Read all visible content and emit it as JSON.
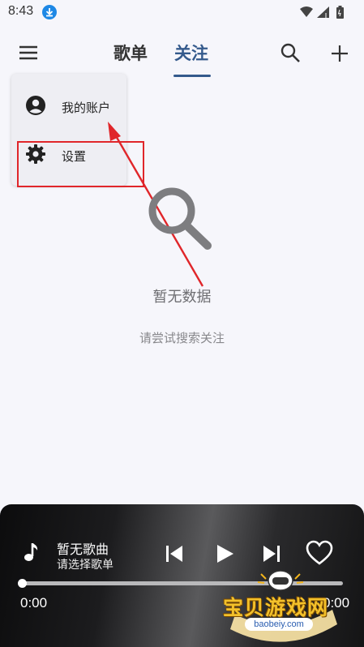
{
  "status_bar": {
    "time": "8:43"
  },
  "header": {
    "tabs": [
      {
        "label": "歌单",
        "selected": false
      },
      {
        "label": "关注",
        "selected": true
      }
    ]
  },
  "menu": {
    "items": [
      {
        "label": "我的账户",
        "icon": "account-circle-icon"
      },
      {
        "label": "设置",
        "icon": "gear-icon"
      }
    ]
  },
  "empty_state": {
    "title": "暂无数据",
    "hint": "请尝试搜索关注"
  },
  "player": {
    "title": "暂无歌曲",
    "subtitle": "请选择歌单",
    "time_current": "0:00",
    "time_total": "0:00",
    "progress": 0
  },
  "watermark": {
    "brand": "宝贝游戏网",
    "url": "baobeiy.com"
  },
  "colors": {
    "accent": "#345a8c",
    "annotation": "#e0262a",
    "background": "#f6f6fb"
  }
}
